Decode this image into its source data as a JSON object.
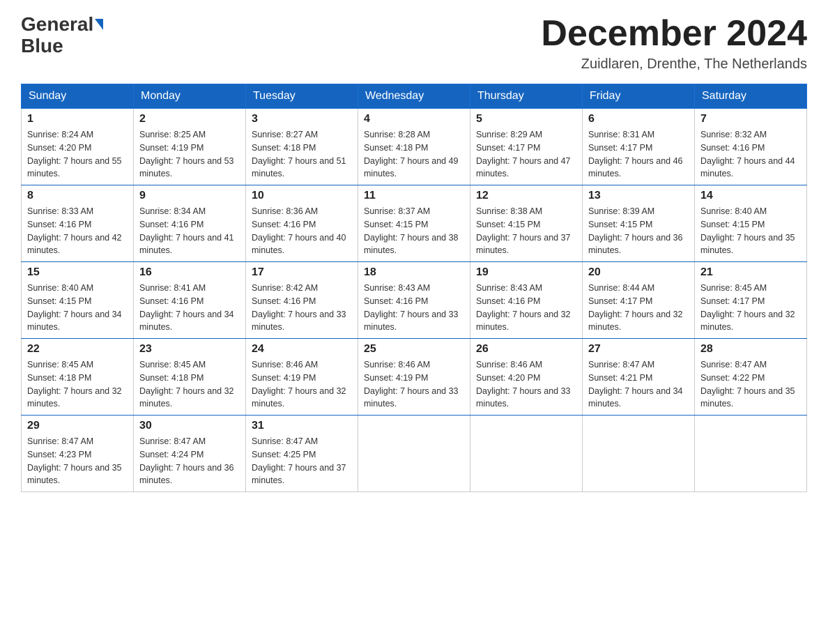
{
  "header": {
    "logo": {
      "line1": "General",
      "line2": "Blue"
    },
    "title": "December 2024",
    "location": "Zuidlaren, Drenthe, The Netherlands"
  },
  "weekdays": [
    "Sunday",
    "Monday",
    "Tuesday",
    "Wednesday",
    "Thursday",
    "Friday",
    "Saturday"
  ],
  "weeks": [
    [
      {
        "day": "1",
        "sunrise": "8:24 AM",
        "sunset": "4:20 PM",
        "daylight": "7 hours and 55 minutes."
      },
      {
        "day": "2",
        "sunrise": "8:25 AM",
        "sunset": "4:19 PM",
        "daylight": "7 hours and 53 minutes."
      },
      {
        "day": "3",
        "sunrise": "8:27 AM",
        "sunset": "4:18 PM",
        "daylight": "7 hours and 51 minutes."
      },
      {
        "day": "4",
        "sunrise": "8:28 AM",
        "sunset": "4:18 PM",
        "daylight": "7 hours and 49 minutes."
      },
      {
        "day": "5",
        "sunrise": "8:29 AM",
        "sunset": "4:17 PM",
        "daylight": "7 hours and 47 minutes."
      },
      {
        "day": "6",
        "sunrise": "8:31 AM",
        "sunset": "4:17 PM",
        "daylight": "7 hours and 46 minutes."
      },
      {
        "day": "7",
        "sunrise": "8:32 AM",
        "sunset": "4:16 PM",
        "daylight": "7 hours and 44 minutes."
      }
    ],
    [
      {
        "day": "8",
        "sunrise": "8:33 AM",
        "sunset": "4:16 PM",
        "daylight": "7 hours and 42 minutes."
      },
      {
        "day": "9",
        "sunrise": "8:34 AM",
        "sunset": "4:16 PM",
        "daylight": "7 hours and 41 minutes."
      },
      {
        "day": "10",
        "sunrise": "8:36 AM",
        "sunset": "4:16 PM",
        "daylight": "7 hours and 40 minutes."
      },
      {
        "day": "11",
        "sunrise": "8:37 AM",
        "sunset": "4:15 PM",
        "daylight": "7 hours and 38 minutes."
      },
      {
        "day": "12",
        "sunrise": "8:38 AM",
        "sunset": "4:15 PM",
        "daylight": "7 hours and 37 minutes."
      },
      {
        "day": "13",
        "sunrise": "8:39 AM",
        "sunset": "4:15 PM",
        "daylight": "7 hours and 36 minutes."
      },
      {
        "day": "14",
        "sunrise": "8:40 AM",
        "sunset": "4:15 PM",
        "daylight": "7 hours and 35 minutes."
      }
    ],
    [
      {
        "day": "15",
        "sunrise": "8:40 AM",
        "sunset": "4:15 PM",
        "daylight": "7 hours and 34 minutes."
      },
      {
        "day": "16",
        "sunrise": "8:41 AM",
        "sunset": "4:16 PM",
        "daylight": "7 hours and 34 minutes."
      },
      {
        "day": "17",
        "sunrise": "8:42 AM",
        "sunset": "4:16 PM",
        "daylight": "7 hours and 33 minutes."
      },
      {
        "day": "18",
        "sunrise": "8:43 AM",
        "sunset": "4:16 PM",
        "daylight": "7 hours and 33 minutes."
      },
      {
        "day": "19",
        "sunrise": "8:43 AM",
        "sunset": "4:16 PM",
        "daylight": "7 hours and 32 minutes."
      },
      {
        "day": "20",
        "sunrise": "8:44 AM",
        "sunset": "4:17 PM",
        "daylight": "7 hours and 32 minutes."
      },
      {
        "day": "21",
        "sunrise": "8:45 AM",
        "sunset": "4:17 PM",
        "daylight": "7 hours and 32 minutes."
      }
    ],
    [
      {
        "day": "22",
        "sunrise": "8:45 AM",
        "sunset": "4:18 PM",
        "daylight": "7 hours and 32 minutes."
      },
      {
        "day": "23",
        "sunrise": "8:45 AM",
        "sunset": "4:18 PM",
        "daylight": "7 hours and 32 minutes."
      },
      {
        "day": "24",
        "sunrise": "8:46 AM",
        "sunset": "4:19 PM",
        "daylight": "7 hours and 32 minutes."
      },
      {
        "day": "25",
        "sunrise": "8:46 AM",
        "sunset": "4:19 PM",
        "daylight": "7 hours and 33 minutes."
      },
      {
        "day": "26",
        "sunrise": "8:46 AM",
        "sunset": "4:20 PM",
        "daylight": "7 hours and 33 minutes."
      },
      {
        "day": "27",
        "sunrise": "8:47 AM",
        "sunset": "4:21 PM",
        "daylight": "7 hours and 34 minutes."
      },
      {
        "day": "28",
        "sunrise": "8:47 AM",
        "sunset": "4:22 PM",
        "daylight": "7 hours and 35 minutes."
      }
    ],
    [
      {
        "day": "29",
        "sunrise": "8:47 AM",
        "sunset": "4:23 PM",
        "daylight": "7 hours and 35 minutes."
      },
      {
        "day": "30",
        "sunrise": "8:47 AM",
        "sunset": "4:24 PM",
        "daylight": "7 hours and 36 minutes."
      },
      {
        "day": "31",
        "sunrise": "8:47 AM",
        "sunset": "4:25 PM",
        "daylight": "7 hours and 37 minutes."
      },
      null,
      null,
      null,
      null
    ]
  ]
}
